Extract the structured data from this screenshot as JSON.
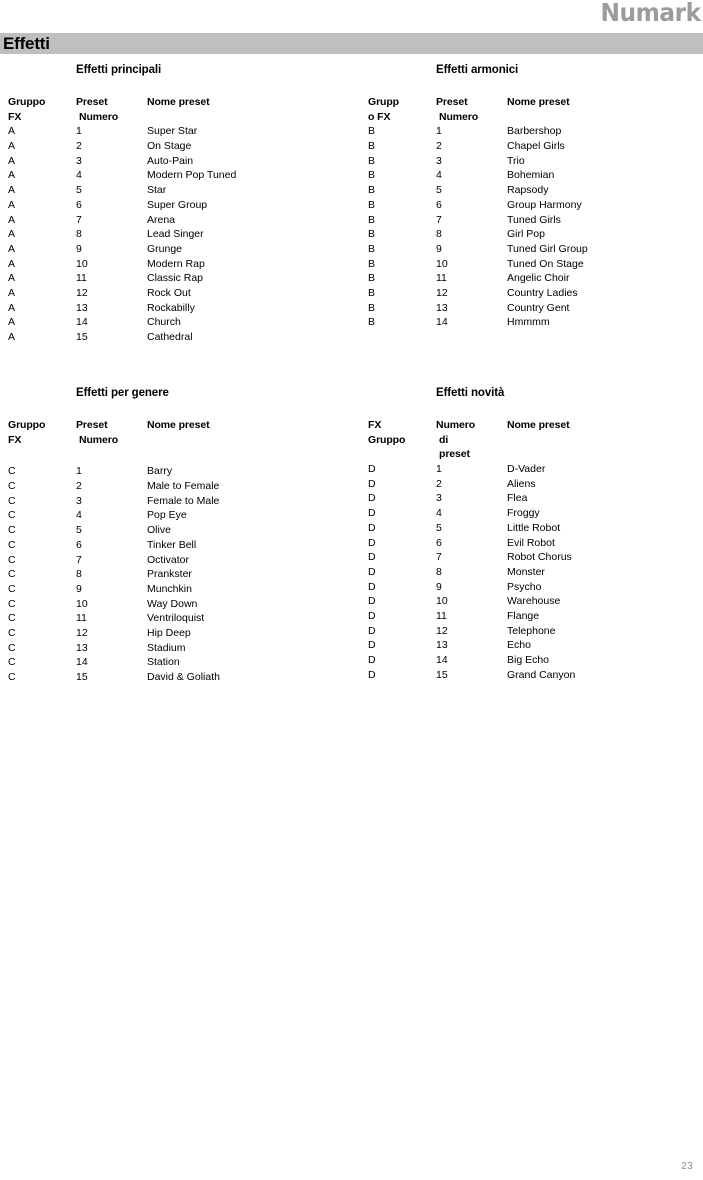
{
  "brand": {
    "logo_text": "Numark"
  },
  "chapter": {
    "title": "Effetti"
  },
  "page": {
    "number": "23"
  },
  "tables": [
    {
      "id": "effetti-principali",
      "title": "Effetti principali",
      "headers": {
        "group_line1": "Gruppo",
        "group_line2": "FX",
        "number_line1": "Preset",
        "number_line2": "Numero",
        "number_line3": "",
        "name": "Nome preset"
      },
      "gap_after_header": false,
      "rows": [
        {
          "group": "A",
          "number": "1",
          "name": "Super Star"
        },
        {
          "group": "A",
          "number": "2",
          "name": "On Stage"
        },
        {
          "group": "A",
          "number": "3",
          "name": "Auto-Pain"
        },
        {
          "group": "A",
          "number": "4",
          "name": "Modern Pop Tuned"
        },
        {
          "group": "A",
          "number": "5",
          "name": "Star"
        },
        {
          "group": "A",
          "number": "6",
          "name": "Super Group"
        },
        {
          "group": "A",
          "number": "7",
          "name": "Arena"
        },
        {
          "group": "A",
          "number": "8",
          "name": "Lead Singer"
        },
        {
          "group": "A",
          "number": "9",
          "name": "Grunge"
        },
        {
          "group": "A",
          "number": "10",
          "name": "Modern Rap"
        },
        {
          "group": "A",
          "number": "11",
          "name": "Classic Rap"
        },
        {
          "group": "A",
          "number": "12",
          "name": "Rock Out"
        },
        {
          "group": "A",
          "number": "13",
          "name": "Rockabilly"
        },
        {
          "group": "A",
          "number": "14",
          "name": "Church"
        },
        {
          "group": "A",
          "number": "15",
          "name": "Cathedral"
        }
      ]
    },
    {
      "id": "effetti-armonici",
      "title": "Effetti armonici",
      "headers": {
        "group_line1": "Grupp",
        "group_line2": "o FX",
        "number_line1": "Preset",
        "number_line2": "Numero",
        "number_line3": "",
        "name": "Nome preset"
      },
      "gap_after_header": false,
      "rows": [
        {
          "group": "B",
          "number": "1",
          "name": "Barbershop"
        },
        {
          "group": "B",
          "number": "2",
          "name": "Chapel Girls"
        },
        {
          "group": "B",
          "number": "3",
          "name": "Trio"
        },
        {
          "group": "B",
          "number": "4",
          "name": "Bohemian"
        },
        {
          "group": "B",
          "number": "5",
          "name": "Rapsody"
        },
        {
          "group": "B",
          "number": "6",
          "name": "Group Harmony"
        },
        {
          "group": "B",
          "number": "7",
          "name": "Tuned Girls"
        },
        {
          "group": "B",
          "number": "8",
          "name": "Girl Pop"
        },
        {
          "group": "B",
          "number": "9",
          "name": "Tuned Girl Group"
        },
        {
          "group": "B",
          "number": "10",
          "name": "Tuned On Stage"
        },
        {
          "group": "B",
          "number": "11",
          "name": "Angelic Choir"
        },
        {
          "group": "B",
          "number": "12",
          "name": "Country Ladies"
        },
        {
          "group": "B",
          "number": "13",
          "name": "Country Gent"
        },
        {
          "group": "B",
          "number": "14",
          "name": "Hmmmm"
        }
      ]
    },
    {
      "id": "effetti-per-genere",
      "title": "Effetti per genere",
      "headers": {
        "group_line1": "Gruppo",
        "group_line2": "FX",
        "number_line1": "Preset",
        "number_line2": "Numero",
        "number_line3": "",
        "name": "Nome preset"
      },
      "gap_after_header": true,
      "rows": [
        {
          "group": "C",
          "number": "1",
          "name": "Barry"
        },
        {
          "group": "C",
          "number": "2",
          "name": "Male to Female"
        },
        {
          "group": "C",
          "number": "3",
          "name": "Female to Male"
        },
        {
          "group": "C",
          "number": "4",
          "name": "Pop Eye"
        },
        {
          "group": "C",
          "number": "5",
          "name": "Olive"
        },
        {
          "group": "C",
          "number": "6",
          "name": "Tinker Bell"
        },
        {
          "group": "C",
          "number": "7",
          "name": "Octivator"
        },
        {
          "group": "C",
          "number": "8",
          "name": "Prankster"
        },
        {
          "group": "C",
          "number": "9",
          "name": "Munchkin"
        },
        {
          "group": "C",
          "number": "10",
          "name": "Way Down"
        },
        {
          "group": "C",
          "number": "11",
          "name": "Ventriloquist"
        },
        {
          "group": "C",
          "number": "12",
          "name": "Hip Deep"
        },
        {
          "group": "C",
          "number": "13",
          "name": "Stadium"
        },
        {
          "group": "C",
          "number": "14",
          "name": "Station"
        },
        {
          "group": "C",
          "number": "15",
          "name": "David & Goliath"
        }
      ]
    },
    {
      "id": "effetti-novita",
      "title": "Effetti novità",
      "headers": {
        "group_line1": "FX",
        "group_line2": "Gruppo",
        "number_line1": "Numero",
        "number_line2": "di",
        "number_line3": "preset",
        "name": "Nome preset"
      },
      "gap_after_header": false,
      "rows": [
        {
          "group": "D",
          "number": "1",
          "name": "D-Vader"
        },
        {
          "group": "D",
          "number": "2",
          "name": "Aliens"
        },
        {
          "group": "D",
          "number": "3",
          "name": "Flea"
        },
        {
          "group": "D",
          "number": "4",
          "name": "Froggy"
        },
        {
          "group": "D",
          "number": "5",
          "name": "Little Robot"
        },
        {
          "group": "D",
          "number": "6",
          "name": "Evil Robot"
        },
        {
          "group": "D",
          "number": "7",
          "name": "Robot Chorus"
        },
        {
          "group": "D",
          "number": "8",
          "name": "Monster"
        },
        {
          "group": "D",
          "number": "9",
          "name": "Psycho"
        },
        {
          "group": "D",
          "number": "10",
          "name": "Warehouse"
        },
        {
          "group": "D",
          "number": "11",
          "name": "Flange"
        },
        {
          "group": "D",
          "number": "12",
          "name": "Telephone"
        },
        {
          "group": "D",
          "number": "13",
          "name": "Echo"
        },
        {
          "group": "D",
          "number": "14",
          "name": "Big Echo"
        },
        {
          "group": "D",
          "number": "15",
          "name": "Grand Canyon"
        }
      ]
    }
  ]
}
